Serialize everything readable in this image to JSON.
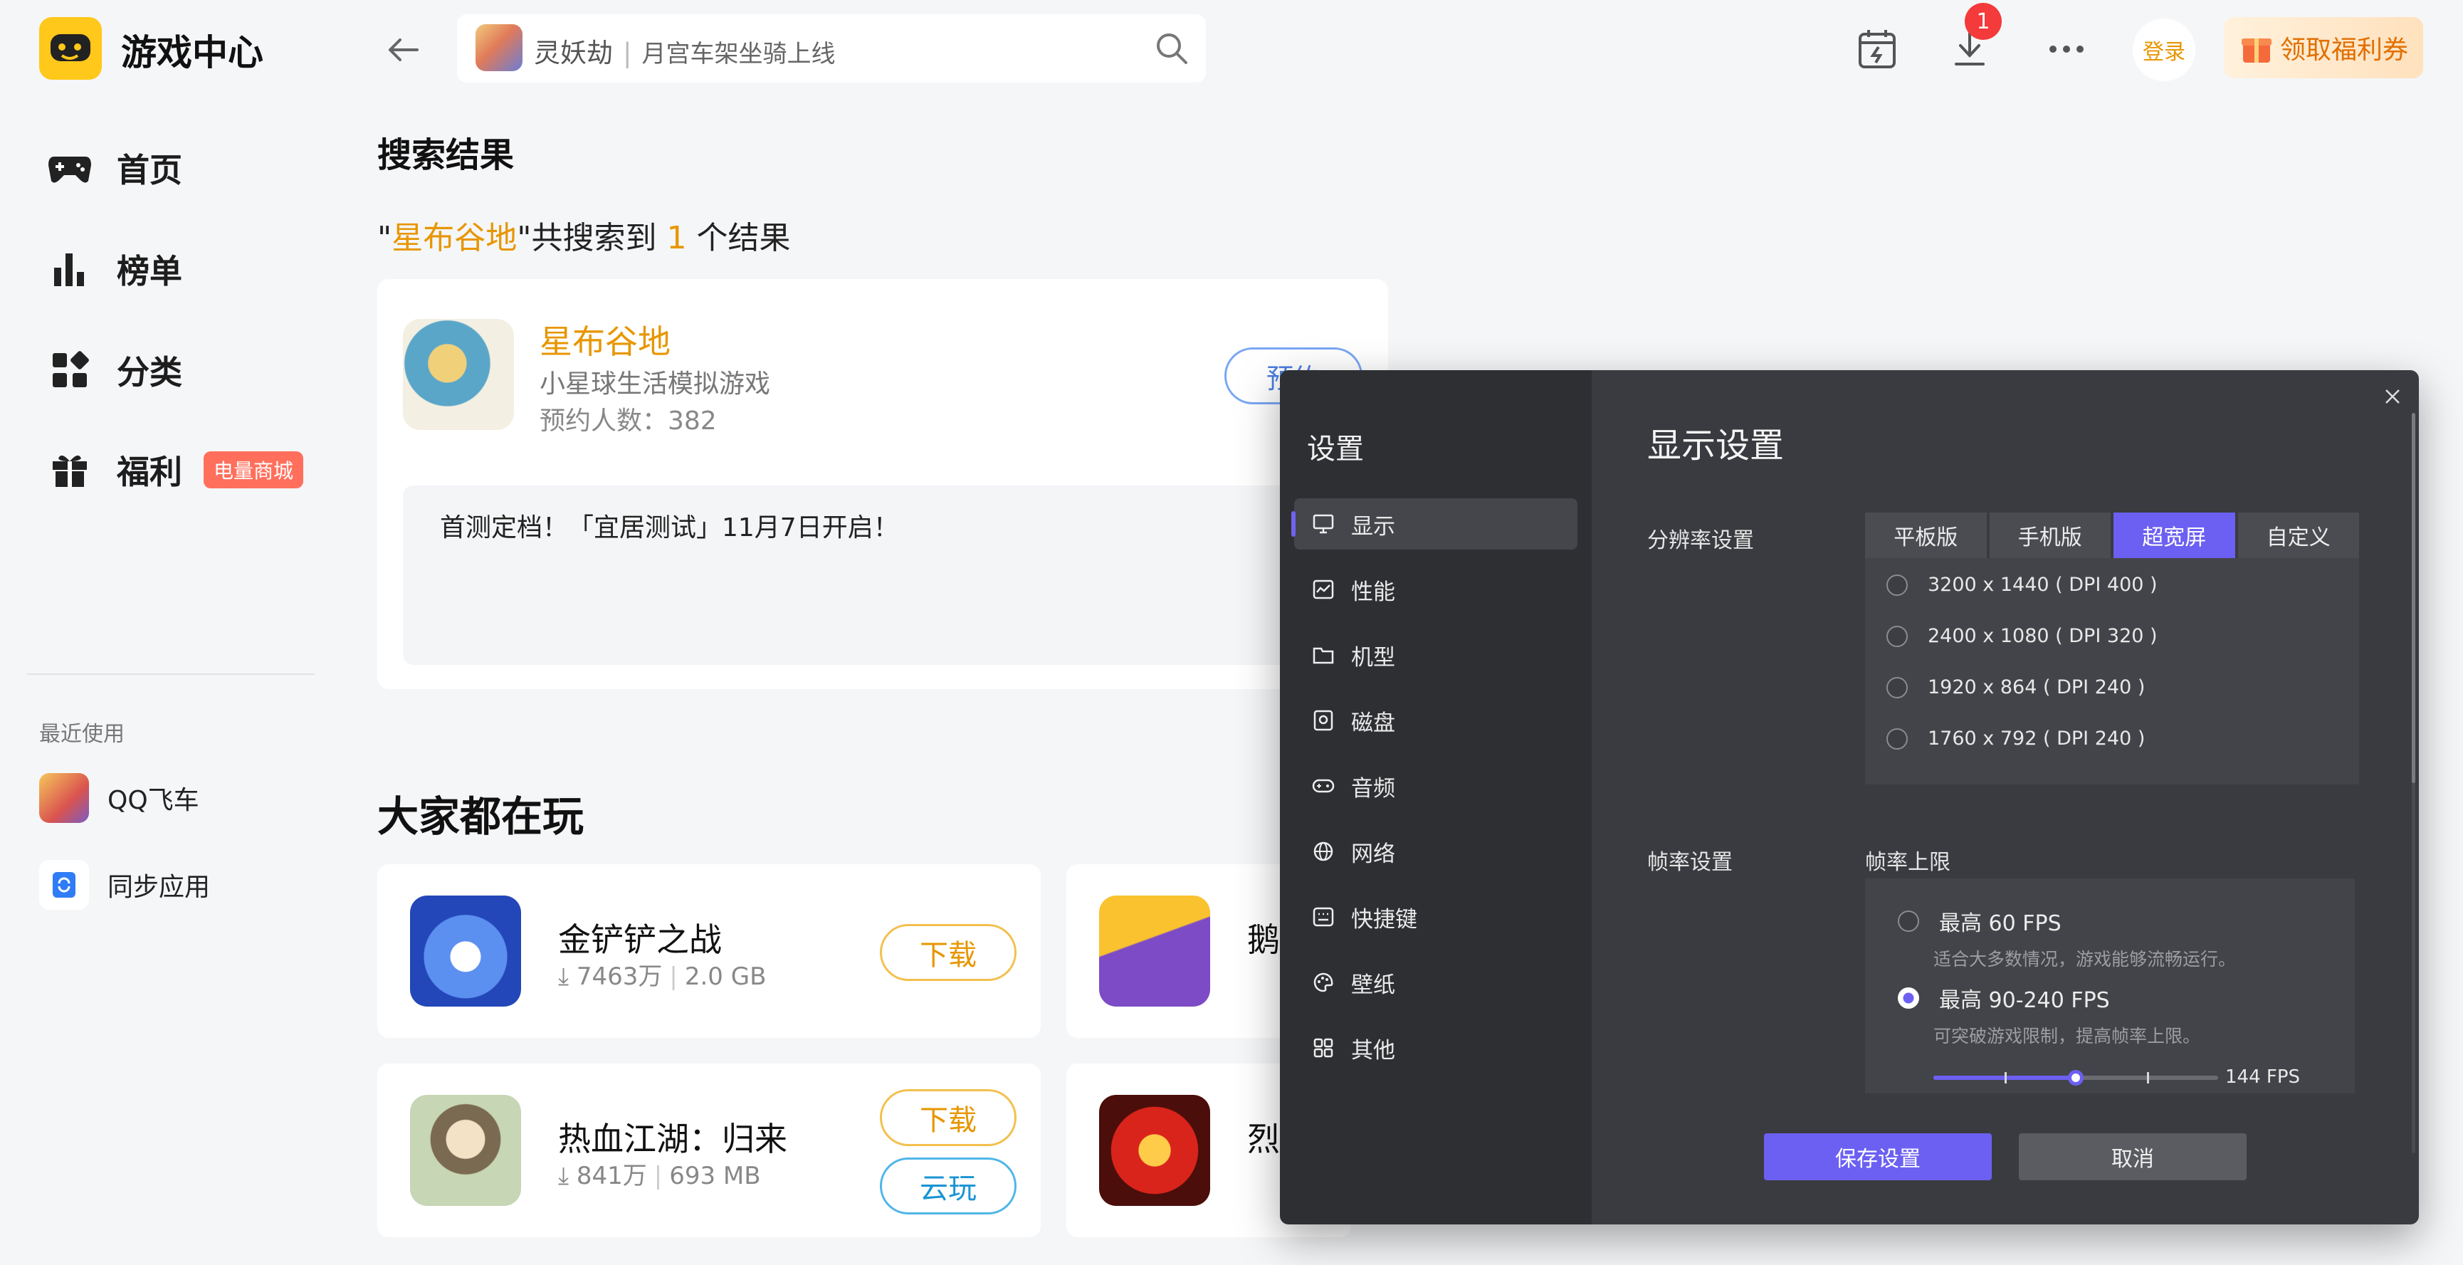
{
  "app": {
    "title": "游戏中心"
  },
  "search": {
    "game": "灵妖劫",
    "subtitle": "月宫车架坐骑上线"
  },
  "header": {
    "download_badge": "1",
    "login_label": "登录",
    "coupon_label": "领取福利券"
  },
  "sidebar": {
    "items": [
      {
        "label": "首页"
      },
      {
        "label": "榜单"
      },
      {
        "label": "分类"
      },
      {
        "label": "福利",
        "tag": "电量商城"
      }
    ],
    "recent_title": "最近使用",
    "recent": [
      {
        "label": "QQ飞车"
      },
      {
        "label": "同步应用"
      }
    ]
  },
  "results": {
    "heading": "搜索结果",
    "query": "星布谷地",
    "prefix": "\"",
    "middle": "\"共搜索到 ",
    "count": "1",
    "suffix": " 个结果",
    "card": {
      "name": "星布谷地",
      "desc": "小星球生活模拟游戏",
      "reservations": "预约人数：382",
      "button": "预约",
      "note": "首测定档！「宜居测试」11月7日开启！"
    }
  },
  "popular": {
    "heading": "大家都在玩",
    "games": [
      {
        "name": "金铲铲之战",
        "downloads": "7463万",
        "size": "2.0 GB",
        "download_label": "下载"
      },
      {
        "name": "热血江湖：归来",
        "downloads": "841万",
        "size": "693 MB",
        "download_label": "下载",
        "cloud_label": "云玩"
      },
      {
        "name": "鹅"
      },
      {
        "name": "烈"
      }
    ]
  },
  "settings": {
    "side_title": "设置",
    "menu": [
      "显示",
      "性能",
      "机型",
      "磁盘",
      "音频",
      "网络",
      "快捷键",
      "壁纸",
      "其他"
    ],
    "title": "显示设置",
    "resolution_label": "分辨率设置",
    "res_tabs": [
      "平板版",
      "手机版",
      "超宽屏",
      "自定义"
    ],
    "active_tab": "超宽屏",
    "resolutions": [
      "3200 x 1440 ( DPI 400 )",
      "2400 x 1080 ( DPI 320 )",
      "1920 x 864 ( DPI 240 )",
      "1760 x 792 ( DPI 240 )"
    ],
    "framerate_label": "帧率设置",
    "fps_cap_label": "帧率上限",
    "fps_options": [
      {
        "title": "最高 60 FPS",
        "desc": "适合大多数情况，游戏能够流畅运行。",
        "selected": false
      },
      {
        "title": "最高 90-240 FPS",
        "desc": "可突破游戏限制，提高帧率上限。",
        "selected": true
      }
    ],
    "fps_value": "144 FPS",
    "fps_slider_fraction": 0.5,
    "save_label": "保存设置",
    "cancel_label": "取消"
  },
  "colors": {
    "accent": "#6c60f2",
    "brand_yellow": "#ffc81a",
    "highlight": "#e79600"
  }
}
